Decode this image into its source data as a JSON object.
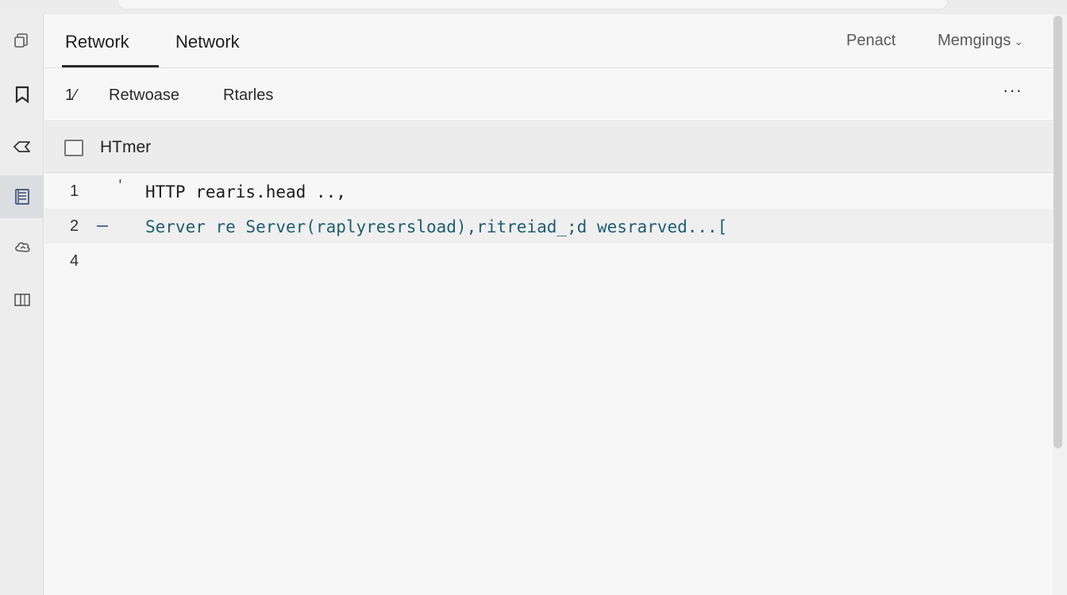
{
  "sidebar": {
    "icons": [
      "copy-icon",
      "bookmark-icon",
      "tag-icon",
      "list-icon",
      "cloud-icon",
      "panel-icon"
    ],
    "active_index": 3
  },
  "tabs": {
    "items": [
      {
        "label": "Retwork",
        "active": true
      },
      {
        "label": "Network",
        "active": false
      }
    ],
    "right": {
      "link_label": "Penact",
      "dropdown_label": "Memgings"
    }
  },
  "toolbar": {
    "items": [
      {
        "label": "1⁄"
      },
      {
        "label": "Retwoase"
      },
      {
        "label": "Rtarles"
      }
    ],
    "more_label": "···"
  },
  "section": {
    "checked": false,
    "title": "HTmer"
  },
  "code": {
    "lines": [
      {
        "number": "1",
        "gutter": "'",
        "text": "HTTP rearis.head ..,"
      },
      {
        "number": "2",
        "gutter": "-",
        "text": "Server re Server(raplyresrsload),ritreiad_;d wesrarved...["
      },
      {
        "number": "4",
        "gutter": "",
        "text": ""
      }
    ]
  }
}
